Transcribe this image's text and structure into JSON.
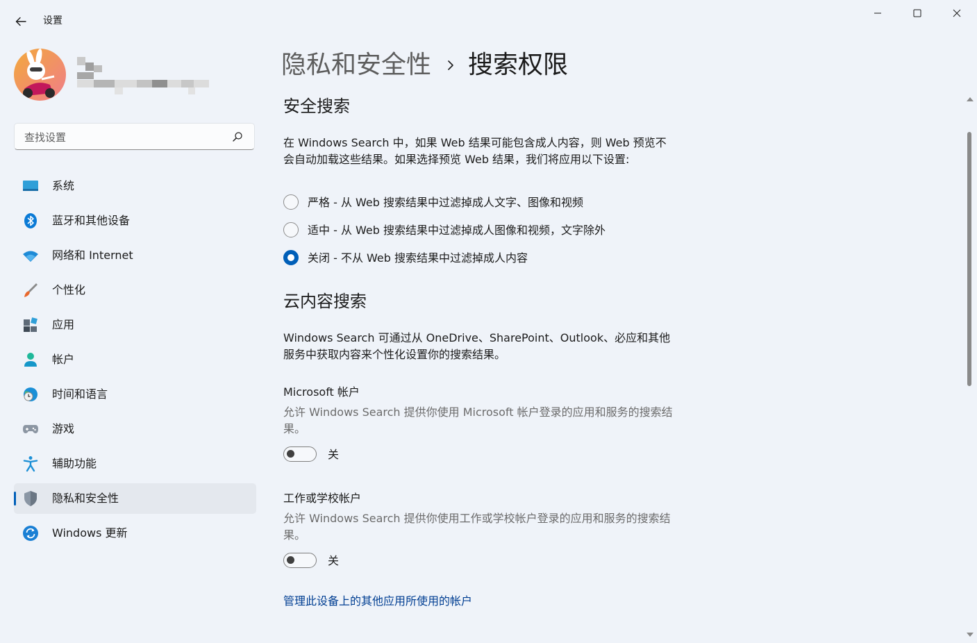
{
  "window": {
    "title": "设置",
    "controls": [
      "minimize-icon",
      "maximize-icon",
      "close-icon"
    ]
  },
  "search": {
    "placeholder": "查找设置"
  },
  "sidebar": {
    "items": [
      {
        "label": "系统",
        "icon": "system-icon"
      },
      {
        "label": "蓝牙和其他设备",
        "icon": "bluetooth-icon"
      },
      {
        "label": "网络和 Internet",
        "icon": "wifi-icon"
      },
      {
        "label": "个性化",
        "icon": "brush-icon"
      },
      {
        "label": "应用",
        "icon": "apps-icon"
      },
      {
        "label": "帐户",
        "icon": "account-icon"
      },
      {
        "label": "时间和语言",
        "icon": "time-language-icon"
      },
      {
        "label": "游戏",
        "icon": "gamepad-icon"
      },
      {
        "label": "辅助功能",
        "icon": "accessibility-icon"
      },
      {
        "label": "隐私和安全性",
        "icon": "shield-icon",
        "selected": true
      },
      {
        "label": "Windows 更新",
        "icon": "windows-update-icon"
      }
    ]
  },
  "breadcrumb": {
    "parent": "隐私和安全性",
    "separator": "›",
    "current": "搜索权限"
  },
  "safe_search": {
    "heading": "安全搜索",
    "description": "在 Windows Search 中，如果 Web 结果可能包含成人内容，则 Web 预览不会自动加载这些结果。如果选择预览 Web 结果，我们将应用以下设置:",
    "options": [
      {
        "label": "严格 - 从 Web 搜索结果中过滤掉成人文字、图像和视频",
        "checked": false
      },
      {
        "label": "适中 - 从 Web 搜索结果中过滤掉成人图像和视频，文字除外",
        "checked": false
      },
      {
        "label": "关闭 - 不从 Web 搜索结果中过滤掉成人内容",
        "checked": true
      }
    ]
  },
  "cloud_search": {
    "heading": "云内容搜索",
    "description": "Windows Search 可通过从 OneDrive、SharePoint、Outlook、必应和其他服务中获取内容来个性化设置你的搜索结果。",
    "microsoft_account": {
      "title": "Microsoft 帐户",
      "description": "允许 Windows Search 提供你使用 Microsoft 帐户登录的应用和服务的搜索结果。",
      "toggle_state": "关",
      "enabled": false
    },
    "work_account": {
      "title": "工作或学校帐户",
      "description": "允许 Windows Search 提供你使用工作或学校帐户登录的应用和服务的搜索结果。",
      "toggle_state": "关",
      "enabled": false
    },
    "manage_link": "管理此设备上的其他应用所使用的帐户"
  },
  "colors": {
    "accent": "#005fb8",
    "link": "#003e92",
    "background": "#eff3f9",
    "selected_nav": "#e4e8ee"
  }
}
